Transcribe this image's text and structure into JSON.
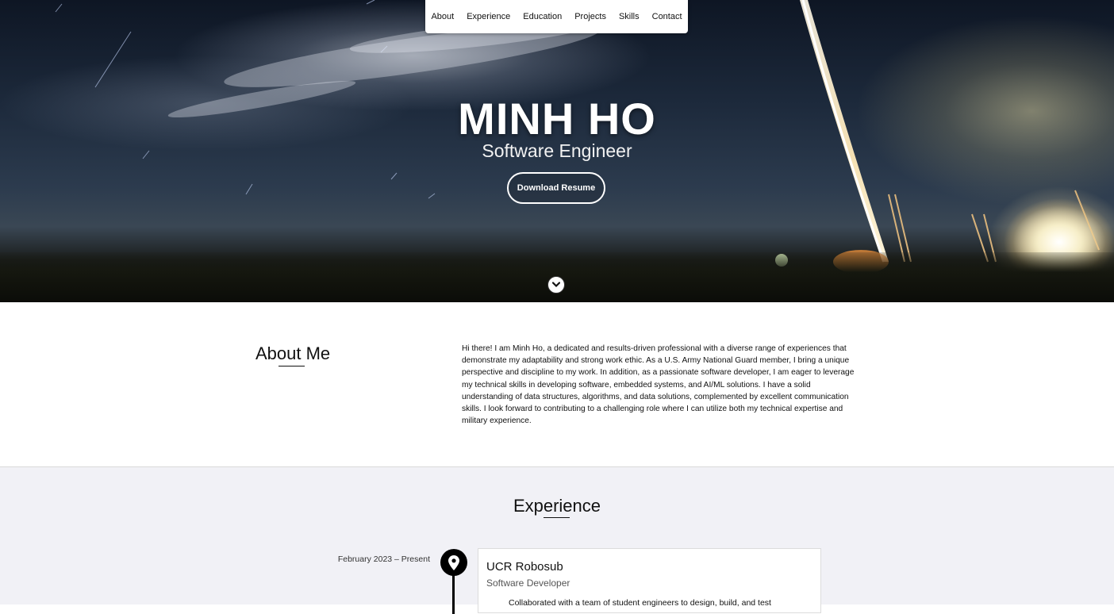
{
  "nav": {
    "items": [
      "About",
      "Experience",
      "Education",
      "Projects",
      "Skills",
      "Contact"
    ]
  },
  "hero": {
    "name": "MINH HO",
    "subtitle": "Software Engineer",
    "resume_button": "Download Resume"
  },
  "about": {
    "heading": "About Me",
    "text": "Hi there! I am Minh Ho, a dedicated and results-driven professional with a diverse range of experiences that demonstrate my adaptability and strong work ethic. As a U.S. Army National Guard member, I bring a unique perspective and discipline to my work. In addition, as a passionate software developer, I am eager to leverage my technical skills in developing software, embedded systems, and AI/ML solutions. I have a solid understanding of data structures, algorithms, and data solutions, complemented by excellent communication skills. I look forward to contributing to a challenging role where I can utilize both my technical expertise and military experience."
  },
  "experience": {
    "heading": "Experience",
    "entries": [
      {
        "date": "February 2023 – Present",
        "org": "UCR Robosub",
        "role": "Software Developer",
        "bullet": "Collaborated with a team of student engineers to design, build, and test"
      }
    ]
  },
  "colors": {
    "accent": "#000000",
    "section_bg": "#f1f1f6"
  }
}
